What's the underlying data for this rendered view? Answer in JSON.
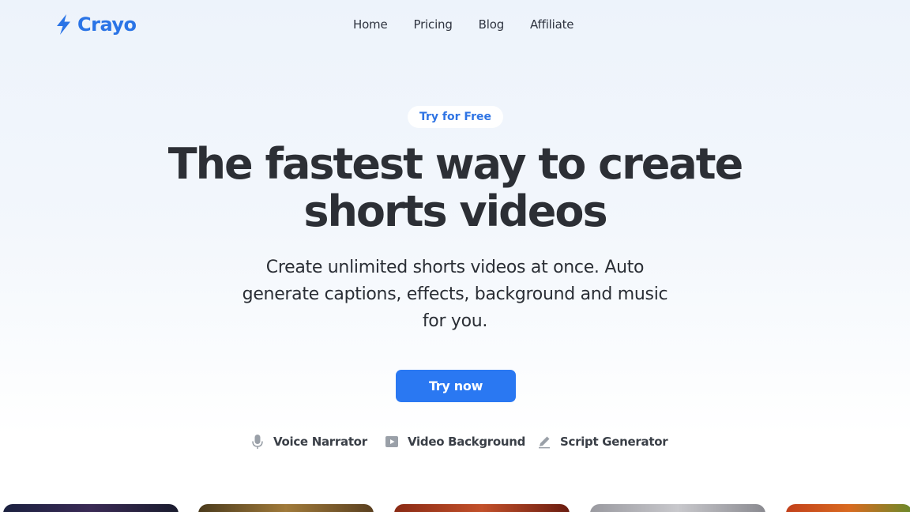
{
  "brand": {
    "name": "Crayo"
  },
  "nav": {
    "items": [
      "Home",
      "Pricing",
      "Blog",
      "Affiliate"
    ]
  },
  "hero": {
    "badge": "Try for Free",
    "headline_line1": "The fastest way to create",
    "headline_line2": "shorts videos",
    "subhead_line1": "Create unlimited shorts videos at once. Auto",
    "subhead_line2": "generate captions, effects, background and music",
    "subhead_line3": "for you.",
    "cta": "Try now"
  },
  "features": [
    {
      "label": "Voice Narrator",
      "icon": "microphone-icon"
    },
    {
      "label": "Video Background",
      "icon": "play-video-icon"
    },
    {
      "label": "Script Generator",
      "icon": "pencil-icon"
    }
  ],
  "colors": {
    "brand": "#2a74e6",
    "cta": "#2a78f2",
    "text": "#2c2f35"
  }
}
